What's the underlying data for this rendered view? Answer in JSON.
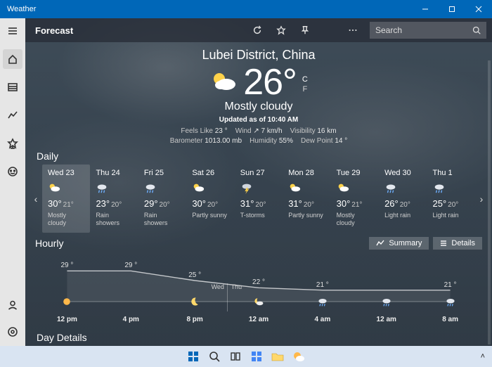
{
  "titlebar": {
    "appname": "Weather"
  },
  "toolbar": {
    "title": "Forecast",
    "search_placeholder": "Search"
  },
  "units": {
    "c": "C",
    "f": "F"
  },
  "hero": {
    "location": "Lubei District, China",
    "temp": "26°",
    "condition": "Mostly cloudy",
    "updated": "Updated as of 10:40 AM",
    "metrics": {
      "feels_label": "Feels Like",
      "feels_val": "23 °",
      "wind_label": "Wind",
      "wind_val": "↗ 7 km/h",
      "vis_label": "Visibility",
      "vis_val": "16 km",
      "baro_label": "Barometer",
      "baro_val": "1013.00 mb",
      "hum_label": "Humidity",
      "hum_val": "55%",
      "dew_label": "Dew Point",
      "dew_val": "14 °"
    }
  },
  "sections": {
    "daily": "Daily",
    "hourly": "Hourly",
    "day_details": "Day Details"
  },
  "daily": [
    {
      "day": "Wed 23",
      "icon": "partly-cloudy",
      "hi": "30°",
      "lo": "21°",
      "cond": "Mostly cloudy",
      "active": true
    },
    {
      "day": "Thu 24",
      "icon": "rain",
      "hi": "23°",
      "lo": "20°",
      "cond": "Rain showers",
      "active": false
    },
    {
      "day": "Fri 25",
      "icon": "rain",
      "hi": "29°",
      "lo": "20°",
      "cond": "Rain showers",
      "active": false
    },
    {
      "day": "Sat 26",
      "icon": "partly-cloudy",
      "hi": "30°",
      "lo": "20°",
      "cond": "Partly sunny",
      "active": false
    },
    {
      "day": "Sun 27",
      "icon": "thunder",
      "hi": "31°",
      "lo": "20°",
      "cond": "T-storms",
      "active": false
    },
    {
      "day": "Mon 28",
      "icon": "partly-cloudy",
      "hi": "31°",
      "lo": "20°",
      "cond": "Partly sunny",
      "active": false
    },
    {
      "day": "Tue 29",
      "icon": "partly-cloudy",
      "hi": "30°",
      "lo": "21°",
      "cond": "Mostly cloudy",
      "active": false
    },
    {
      "day": "Wed 30",
      "icon": "rain",
      "hi": "26°",
      "lo": "20°",
      "cond": "Light rain",
      "active": false
    },
    {
      "day": "Thu 1",
      "icon": "rain",
      "hi": "25°",
      "lo": "20°",
      "cond": "Light rain",
      "active": false
    }
  ],
  "hourly_buttons": {
    "summary": "Summary",
    "details": "Details"
  },
  "chart_data": {
    "type": "line",
    "title": "Hourly temperature",
    "xlabel": "",
    "ylabel": "",
    "ylim": [
      18,
      32
    ],
    "divider_between": {
      "index": 3,
      "left_label": "Wed",
      "right_label": "Thu"
    },
    "points": [
      {
        "time": "12 pm",
        "temp": 29,
        "label": "29 °",
        "icon": "sun"
      },
      {
        "time": "4 pm",
        "temp": 29,
        "label": "29 °",
        "icon": null
      },
      {
        "time": "8 pm",
        "temp": 25,
        "label": "25 °",
        "icon": "moon"
      },
      {
        "time": "12 am",
        "temp": 22,
        "label": "22 °",
        "icon": "night-cloudy"
      },
      {
        "time": "4 am",
        "temp": 21,
        "label": "21 °",
        "icon": "rain"
      },
      {
        "time": "12 am_dup",
        "temp": 21,
        "label": null,
        "icon": "rain",
        "time_display": "12 am"
      },
      {
        "time": "8 am",
        "temp": 21,
        "label": "21 °",
        "icon": "rain"
      }
    ]
  }
}
